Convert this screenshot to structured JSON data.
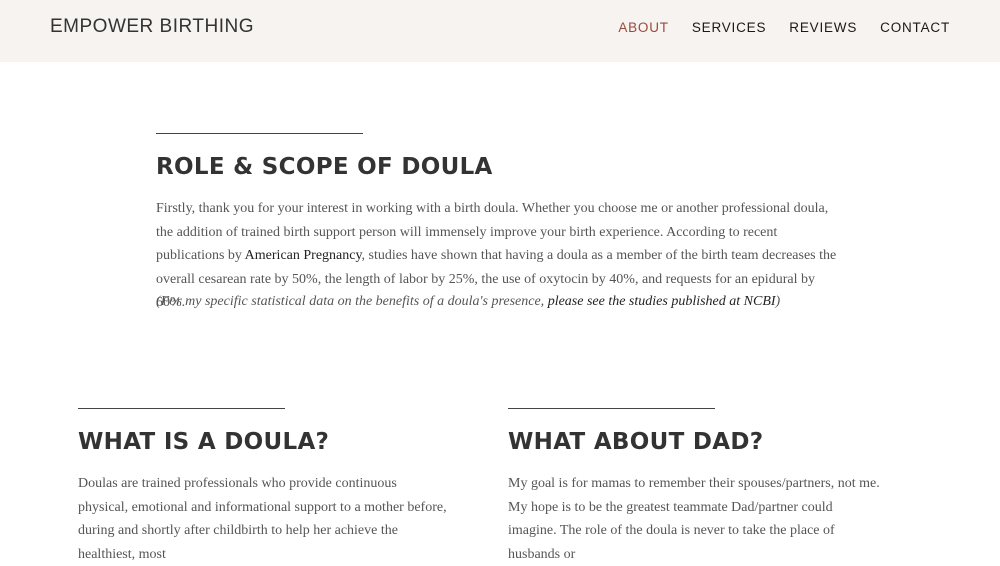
{
  "header": {
    "brand": "EMPOWER BIRTHING",
    "nav": [
      "ABOUT",
      "SERVICES",
      "REVIEWS",
      "CONTACT"
    ],
    "active": "ABOUT",
    "colors": {
      "background": "#f6f3f0",
      "active_link": "#9a4a3c"
    }
  },
  "role": {
    "title": "ROLE & SCOPE OF DOULA",
    "text_1": "Firstly, thank you for your interest in working with a birth doula. Whether you choose me or another professional doula, the addition of trained birth support person will immensely improve your birth experience. According to recent publications by ",
    "link": "American Pregnancy",
    "text_2": ", studies have shown that having a doula as a member of the birth team decreases the overall cesarean rate by 50%, the length of labor by 25%, the use of oxytocin by 40%, and requests for an epidural by 60%.",
    "note_text": "(For my specific statistical data on the benefits of a doula's presence, ",
    "note_link": "please see the studies published at NCBI",
    "note_end": ")"
  },
  "what_is": {
    "title": "WHAT IS A DOULA?",
    "text": "Doulas are trained professionals who provide continuous physical, emotional and informational support to a mother before, during and shortly after childbirth to help her achieve the healthiest, most"
  },
  "dad": {
    "title": "WHAT ABOUT DAD?",
    "text": "My goal is for mamas to remember their spouses/partners, not me. My hope is to be the greatest teammate Dad/partner could imagine. The role of the doula is never to take the place of husbands or"
  }
}
